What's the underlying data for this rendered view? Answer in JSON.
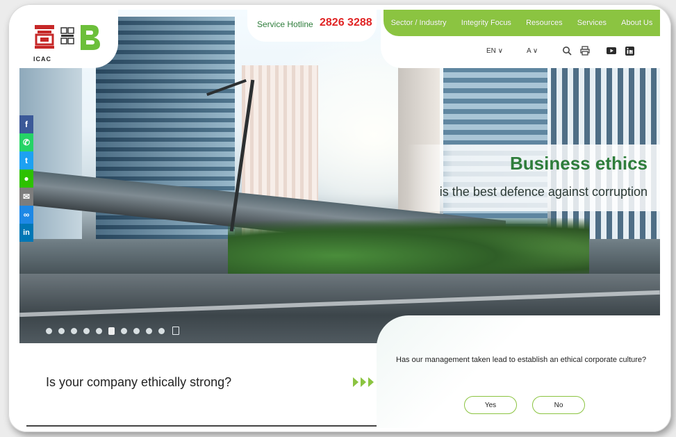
{
  "brand": {
    "logo_text": "ICAC",
    "colors": {
      "green": "#8bc441",
      "dark_green": "#2e7d3b",
      "hotline_red": "#e02424"
    }
  },
  "hotline": {
    "label": "Service Hotline",
    "number": "2826 3288"
  },
  "nav": {
    "items": [
      {
        "label": "Sector / Industry"
      },
      {
        "label": "Integrity Focus"
      },
      {
        "label": "Resources"
      },
      {
        "label": "Services"
      },
      {
        "label": "About Us"
      }
    ]
  },
  "tools": {
    "language": "EN ∨",
    "font_size": "A ∨",
    "icons": [
      "search-icon",
      "print-icon",
      "youtube-icon",
      "linkedin-icon"
    ]
  },
  "share": {
    "buttons": [
      {
        "name": "facebook",
        "glyph": "f",
        "color": "#3b5998"
      },
      {
        "name": "whatsapp",
        "glyph": "✆",
        "color": "#25d366"
      },
      {
        "name": "twitter",
        "glyph": "t",
        "color": "#1da1f2"
      },
      {
        "name": "wechat",
        "glyph": "●",
        "color": "#2dc100"
      },
      {
        "name": "email",
        "glyph": "✉",
        "color": "#7d7d7d"
      },
      {
        "name": "copy-link",
        "glyph": "∞",
        "color": "#1e88e5"
      },
      {
        "name": "linkedin",
        "glyph": "in",
        "color": "#0077b5"
      }
    ]
  },
  "hero": {
    "title": "Business ethics",
    "subtitle": "is the best defence against corruption",
    "slide_count": 10,
    "active_slide": 6
  },
  "cta": {
    "question": "Is your company ethically strong?"
  },
  "quiz": {
    "question": "Has our management taken lead to establish an ethical corporate culture?",
    "yes_label": "Yes",
    "no_label": "No"
  }
}
